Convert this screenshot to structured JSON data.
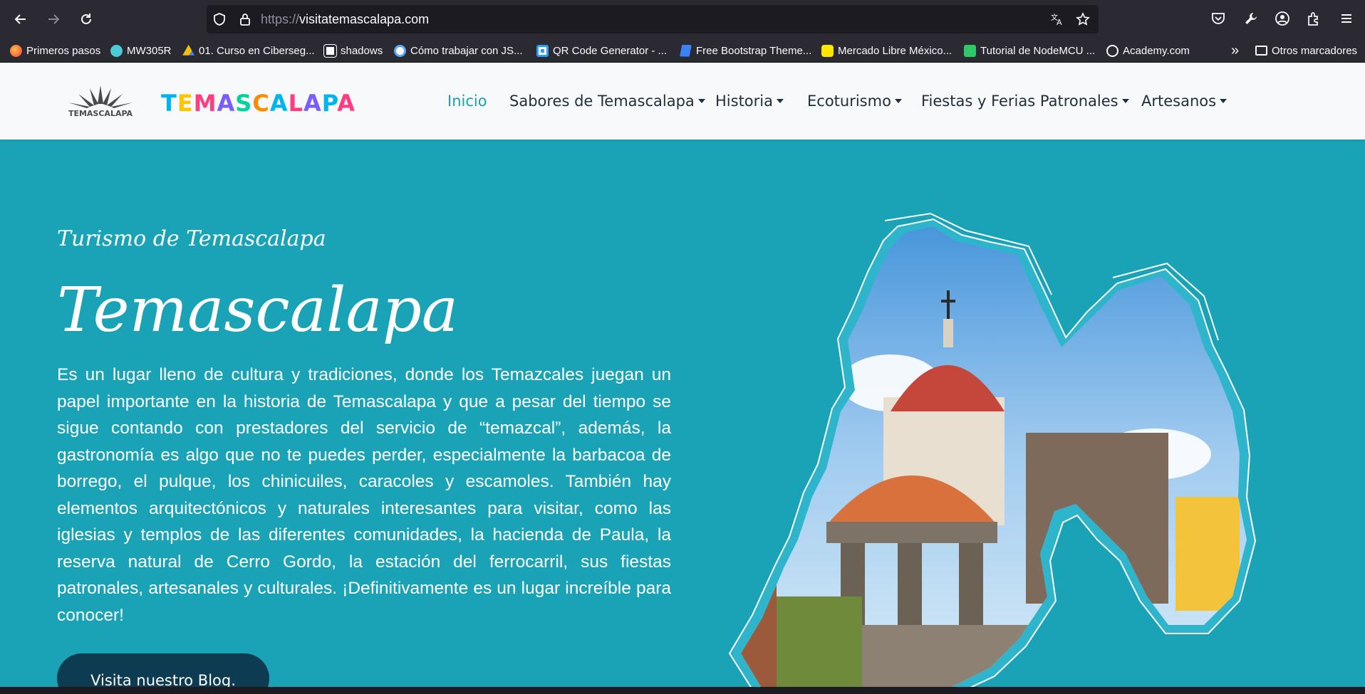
{
  "browser": {
    "url_protocol": "https://",
    "url_host": "visitatemascalapa.com"
  },
  "bookmarks": [
    {
      "label": "Primeros pasos",
      "icon": "firefox-icon",
      "color": "#ff7139"
    },
    {
      "label": "MW305R",
      "icon": "tplink-icon",
      "color": "#4acbd6"
    },
    {
      "label": "01. Curso en Ciberseg...",
      "icon": "drive-icon",
      "color": "#fbbc04"
    },
    {
      "label": "shadows",
      "icon": "shadows-icon",
      "color": "#ffffff"
    },
    {
      "label": "Cómo trabajar con JS...",
      "icon": "globe-icon",
      "color": "#59a6ff"
    },
    {
      "label": "QR Code Generator - ...",
      "icon": "qr-icon",
      "color": "#2a9df4"
    },
    {
      "label": "Free Bootstrap Theme...",
      "icon": "bootstrap-icon",
      "color": "#3b82f6"
    },
    {
      "label": "Mercado Libre México...",
      "icon": "mercadolibre-icon",
      "color": "#ffe600"
    },
    {
      "label": "Tutorial de NodeMCU ...",
      "icon": "nodemcu-icon",
      "color": "#2ec866"
    },
    {
      "label": "Academy.com",
      "icon": "globe-icon",
      "color": "#fbfbfe"
    }
  ],
  "other_bookmarks": "Otros marcadores",
  "site": {
    "logo_caption": "TEMASCALAPA",
    "brand": "TEMASCALAPA",
    "brand_colors": [
      "#00b4f0",
      "#ffc400",
      "#ff3d7f",
      "#7a5cff",
      "#00d2a0",
      "#ff8a00",
      "#00b4f0",
      "#ff3d7f",
      "#7a5cff",
      "#00b4f0",
      "#ff3d7f"
    ],
    "nav": {
      "inicio": "Inicio",
      "sabores": "Sabores de Temascalapa",
      "historia": "Historia",
      "ecoturismo": "Ecoturismo",
      "fiestas": "Fiestas y Ferias Patronales",
      "artesanos": "Artesanos"
    },
    "hero": {
      "subtitle": "Turismo de Temascalapa",
      "title": "Temascalapa",
      "text": "Es un lugar lleno de cultura y tradiciones, donde los Temazcales juegan un papel importante en la historia de Temascalapa y que a pesar del tiempo se sigue contando con prestadores del servicio de “temazcal”, además, la gastronomía es algo que no te puedes perder, especialmente la barbacoa de borrego, el pulque, los chinicuiles, caracoles y escamoles. También hay elementos arquitectónicos y naturales interesantes para visitar, como las iglesias y templos de las diferentes comunidades, la hacienda de Paula, la reserva natural de Cerro Gordo, la estación del ferrocarril, sus fiestas patronales, artesanales y culturales. ¡Definitivamente es un lugar increíble para conocer!",
      "cta": "Visita nuestro Blog."
    }
  },
  "colors": {
    "hero_bg": "#1aa3b7",
    "nav_active": "#18a0b4",
    "cta_bg": "#0c3b52"
  }
}
